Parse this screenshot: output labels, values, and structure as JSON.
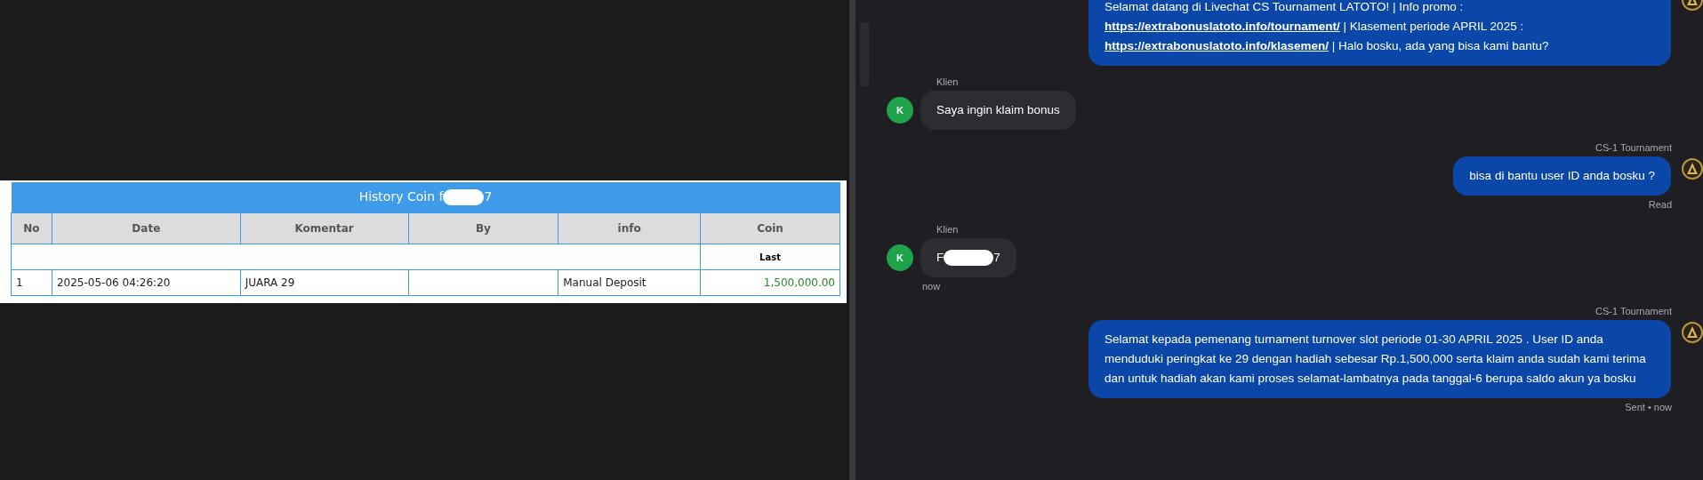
{
  "history_table": {
    "title": "History Coin f",
    "title_end": "7",
    "columns": [
      "No",
      "Date",
      "Komentar",
      "By",
      "info",
      "Coin"
    ],
    "subheader": "Last",
    "rows": [
      {
        "no": "1",
        "date": "2025-05-06 04:26:20",
        "komentar": "JUARA 29",
        "info": "Manual Deposit",
        "coin": "1,500,000.00"
      }
    ]
  },
  "chat": {
    "messages": [
      {
        "kind": "agent",
        "segments": [
          {
            "kind": "text",
            "text": "Selamat datang di Livechat CS Tournament LATOTO! | Info promo :"
          },
          {
            "kind": "link",
            "text": "https://extrabonuslatoto.info/tournament/"
          },
          {
            "kind": "text",
            "text": "| Klasement periode APRIL 2025 :"
          },
          {
            "kind": "link",
            "text": "https://extrabonuslatoto.info/klasemen/"
          },
          {
            "kind": "text",
            "text": "| Halo bosku, ada yang bisa kami bantu?"
          }
        ]
      },
      {
        "kind": "client",
        "sender": "Klien",
        "avatar": "K",
        "segments": [
          {
            "kind": "text",
            "text": "Saya ingin klaim bonus"
          }
        ]
      },
      {
        "kind": "agent",
        "sender": "CS-1 Tournament",
        "status": "Read",
        "segments": [
          {
            "kind": "text",
            "text": "bisa di bantu user ID anda bosku ?"
          }
        ]
      },
      {
        "kind": "client",
        "sender": "Klien",
        "avatar": "K",
        "status": "now",
        "segments": [
          {
            "kind": "text",
            "text": "F"
          },
          {
            "kind": "redaction"
          },
          {
            "kind": "text",
            "text": "7"
          }
        ]
      },
      {
        "kind": "agent",
        "sender": "CS-1 Tournament",
        "status": "Sent • now",
        "segments": [
          {
            "kind": "text",
            "text": "Selamat kepada pemenang turnament turnover slot periode 01-30 APRIL 2025 . User ID anda menduduki peringkat ke 29 dengan hadiah sebesar Rp.1,500,000 serta klaim anda sudah kami terima dan untuk hadiah akan kami proses selamat-lambatnya pada tanggal-6 berupa saldo akun ya bosku"
          }
        ]
      }
    ]
  }
}
